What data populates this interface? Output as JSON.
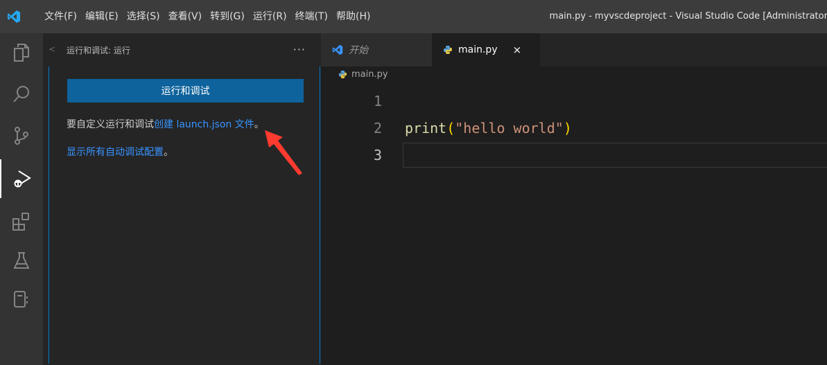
{
  "titlebar": {
    "menu": [
      "文件(F)",
      "编辑(E)",
      "选择(S)",
      "查看(V)",
      "转到(G)",
      "运行(R)",
      "终端(T)",
      "帮助(H)"
    ],
    "window_title": "main.py - myvscdeproject - Visual Studio Code [Administrator]"
  },
  "activitybar": {
    "items": [
      "explorer-icon",
      "search-icon",
      "source-control-icon",
      "run-debug-icon",
      "extensions-icon",
      "testing-icon",
      "notebook-icon"
    ],
    "active": "run-debug-icon"
  },
  "sidebar": {
    "title": "运行和调试: 运行",
    "more": "···",
    "run_button": "运行和调试",
    "customize_prefix": "要自定义运行和调试",
    "customize_link": "创建 launch.json 文件",
    "customize_suffix": "。",
    "show_all_link": "显示所有自动调试配置",
    "show_all_suffix": "。"
  },
  "tabs": [
    {
      "label": "开始",
      "active": false
    },
    {
      "label": "main.py",
      "active": true,
      "close": "×"
    }
  ],
  "breadcrumb": "main.py",
  "editor": {
    "lines": [
      {
        "number": "1",
        "code": ""
      },
      {
        "number": "2",
        "fn": "print",
        "open": "(",
        "str": "\"hello world\"",
        "close": ")"
      },
      {
        "number": "3",
        "code": ""
      }
    ],
    "current_line": "3"
  },
  "colors": {
    "accent": "#0e639c",
    "link": "#3794ff",
    "focus_border": "#007fd4",
    "annotation_arrow": "#ff3b30"
  }
}
